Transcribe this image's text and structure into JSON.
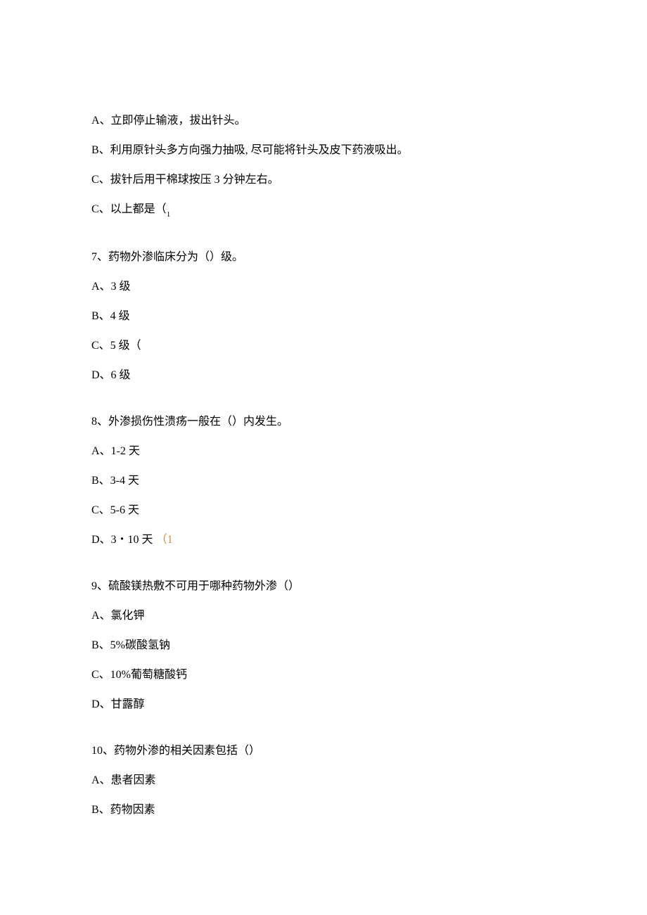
{
  "q6": {
    "a": "A、立即停止输液，拔出针头。",
    "b": "B、利用原针头多方向强力抽吸, 尽可能将针头及皮下药液吸出。",
    "c": "C、拔针后用干棉球按压 3 分钟左右。",
    "c2_prefix": "C、以上都是（",
    "c2_sub": "1"
  },
  "q7": {
    "stem": "7、药物外渗临床分为（）级。",
    "a": "A、3 级",
    "b": "B、4 级",
    "c": "C、5 级（",
    "d": "D、6 级"
  },
  "q8": {
    "stem": "8、外渗损伤性溃疡一般在（）内发生。",
    "a": "A、1-2 天",
    "b": "B、3-4 天",
    "c": "C、5-6 天",
    "d_prefix": "D、3・10 天 ",
    "d_orange": "（1"
  },
  "q9": {
    "stem": "9、硫酸镁热敷不可用于哪种药物外渗（）",
    "a": "A、氯化钾",
    "b": "B、5%碳酸氢钠",
    "c": "C、10%葡萄糖酸钙",
    "d": "D、甘露醇"
  },
  "q10": {
    "stem": "10、药物外渗的相关因素包括（）",
    "a": "A、患者因素",
    "b": "B、药物因素"
  }
}
